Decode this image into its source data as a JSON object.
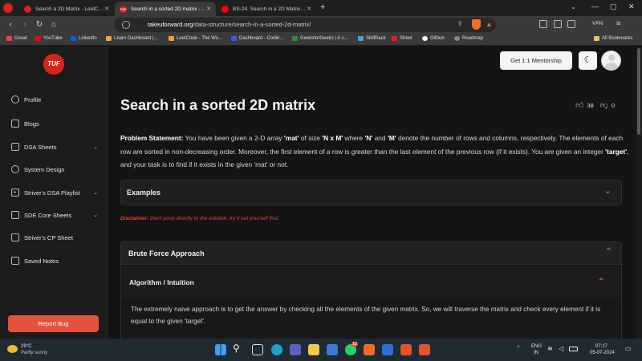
{
  "tabs": [
    {
      "title": "Search a 2D Matrix - LeetCode",
      "active": false
    },
    {
      "title": "Search in a sorted 2D matrix - Ta",
      "active": true
    },
    {
      "title": "BS-24. Search in a 2D Matrix - I | Bin",
      "active": false
    }
  ],
  "address": {
    "domain": "takeuforward.org",
    "path": "/data-structure/search-in-a-sorted-2d-matrix/",
    "vpn": "VPN"
  },
  "bookmarks": [
    {
      "label": "Gmail",
      "color": "#ea4335"
    },
    {
      "label": "YouTube",
      "color": "#ff0000"
    },
    {
      "label": "LinkedIn",
      "color": "#0a66c2"
    },
    {
      "label": "Learn Dashboard |...",
      "color": "#f5a623"
    },
    {
      "label": "LeetCode - The Wo...",
      "color": "#f89f1b"
    },
    {
      "label": "Dashboard - Codin...",
      "color": "#3b5bdb"
    },
    {
      "label": "GeeksforGeeks | A c...",
      "color": "#2f8d46"
    },
    {
      "label": "SkillRack",
      "color": "#4aa3df"
    },
    {
      "label": "Sheet",
      "color": "#d9231a"
    },
    {
      "label": "Github",
      "color": "#ffffff"
    },
    {
      "label": "Roadmap",
      "color": "#888888"
    }
  ],
  "all_bookmarks": "All Bookmarks",
  "logo": "TUF",
  "sidebar": [
    {
      "label": "Profile",
      "icon": "profile-icon",
      "chevron": false
    },
    {
      "label": "Blogs",
      "icon": "blog-icon",
      "chevron": false
    },
    {
      "label": "DSA Sheets",
      "icon": "sheet-icon",
      "chevron": true
    },
    {
      "label": "System Design",
      "icon": "system-design-icon",
      "chevron": false
    },
    {
      "label": "Striver's DSA Playlist",
      "icon": "playlist-icon",
      "chevron": true
    },
    {
      "label": "SDE Core Sheets",
      "icon": "core-sheet-icon",
      "chevron": true
    },
    {
      "label": "Striver's CP Sheet",
      "icon": "cp-sheet-icon",
      "chevron": false
    },
    {
      "label": "Saved Notes",
      "icon": "bookmark-icon",
      "chevron": false
    }
  ],
  "report_bug": "Report Bug",
  "header": {
    "mentorship": "Get 1:1 Mentorship"
  },
  "main": {
    "title": "Search in a sorted 2D matrix",
    "likes": "38",
    "dislikes": "0",
    "statement_label": "Problem Statement:",
    "statement_html_parts": [
      {
        "t": " You have been given a 2-D array ",
        "b": false
      },
      {
        "t": "'mat'",
        "b": true
      },
      {
        "t": " of size ",
        "b": false
      },
      {
        "t": "'N x M'",
        "b": true
      },
      {
        "t": " where ",
        "b": false
      },
      {
        "t": "'N'",
        "b": true
      },
      {
        "t": " and ",
        "b": false
      },
      {
        "t": "'M'",
        "b": true
      },
      {
        "t": " denote the number of rows and columns, respectively. The elements of each row are sorted in non-decreasing order. Moreover, the first element of a row is greater than the last element of the previous row (if it exists). You are given an integer ",
        "b": false
      },
      {
        "t": "'target'",
        "b": true
      },
      {
        "t": ", and your task is to find if it exists in the given 'mat' or not.",
        "b": false
      }
    ],
    "examples": "Examples",
    "disclaimer_label": "Disclaimer:",
    "disclaimer_text": " Don't jump directly to the solution, try it out yourself first.",
    "brute_force": "Brute Force Approach",
    "algorithm": "Algorithm / Intuition",
    "algo_text": "The extremely naive approach is to get the answer by checking all the elements of the given matrix. So, we will traverse the matrix and check every element if it is equal to the given 'target'."
  },
  "taskbar": {
    "weather_temp": "29°C",
    "weather_desc": "Partly sunny",
    "lang1": "ENG",
    "lang2": "IN",
    "time": "07:17",
    "date": "05-07-2024",
    "badge": "13"
  },
  "colors": {
    "accent": "#e4523c",
    "brand": "#d9231a",
    "background": "#141414",
    "panel": "#1f1f1f"
  }
}
